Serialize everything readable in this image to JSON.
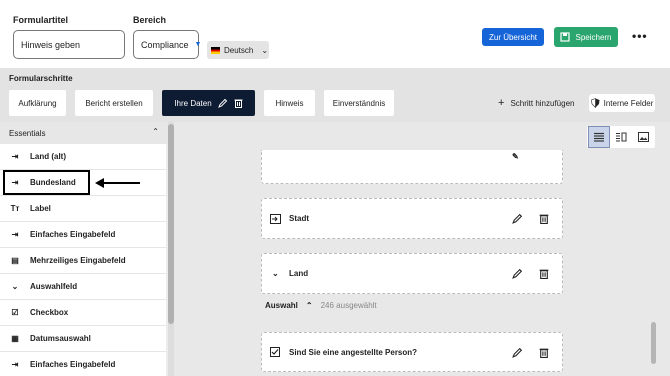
{
  "header": {
    "formtitle_label": "Formulartitel",
    "formtitle_value": "Hinweis geben",
    "area_label": "Bereich",
    "area_value": "Compliance",
    "language": "Deutsch",
    "overview_button": "Zur Übersicht",
    "save_button": "Speichern"
  },
  "steps": {
    "title": "Formularschritte",
    "items": [
      "Aufklärung",
      "Bericht erstellen",
      "Ihre Daten",
      "Hinweis",
      "Einverständnis"
    ],
    "add_step": "Schritt hinzufügen",
    "internal_fields": "Interne Felder"
  },
  "sidebar": {
    "section": "Essentials",
    "items": [
      "Land (alt)",
      "Bundesland",
      "Label",
      "Einfaches Eingabefeld",
      "Mehrzeiliges Eingabefeld",
      "Auswahlfeld",
      "Checkbox",
      "Datumsauswahl",
      "Einfaches Eingabefeld"
    ],
    "icons": [
      "input-icon",
      "input-icon",
      "text-icon",
      "input-icon",
      "textarea-icon",
      "chevron-down-icon",
      "checkbox-icon",
      "calendar-icon",
      "input-icon"
    ]
  },
  "main": {
    "fields": [
      "Stadt",
      "Land",
      "Sind Sie eine angestellte Person?"
    ],
    "selection_label": "Auswahl",
    "selection_count": "246 ausgewählt"
  },
  "colors": {
    "primary": "#1565d8",
    "save": "#2aa56d",
    "active_step": "#0d1b33"
  }
}
